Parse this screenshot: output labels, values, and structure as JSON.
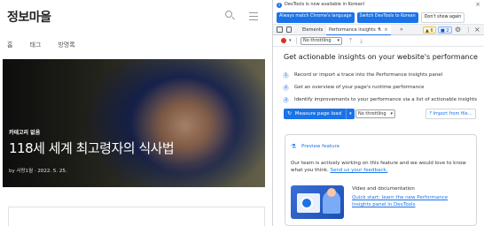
{
  "blog": {
    "site_title": "정보마을",
    "nav": [
      "홈",
      "태그",
      "방명록"
    ],
    "hero": {
      "category": "카테고리 없음",
      "title": "118세 세계 최고령자의 식사법",
      "meta_by": "by 사랑1월",
      "meta_date": "· 2022. 5. 25."
    }
  },
  "devtools": {
    "infobar": {
      "text": "DevTools is now available in Korean!",
      "buttons": [
        "Always match Chrome's language",
        "Switch DevTools to Korean",
        "Don't show again"
      ]
    },
    "tabs": {
      "elements": "Elements",
      "performance_insights": "Performance insights",
      "warnings": "6",
      "infos": "2"
    },
    "toolbar": {
      "throttle_label": "No throttling"
    },
    "performance": {
      "heading": "Get actionable insights on your website's performance",
      "steps": [
        {
          "num": "1",
          "text": "Record or import a trace into the Performance insights panel"
        },
        {
          "num": "2",
          "text": "Get an overview of your page's runtime performance"
        },
        {
          "num": "3",
          "text": "Identify improvements to your performance via a list of actionable insights"
        }
      ],
      "measure_label": "Measure page load",
      "throttle2_label": "No throttling",
      "import_label": "Import from file..."
    },
    "preview": {
      "title": "Preview feature",
      "desc": "Our team is actively working on this feature and we would love to know what you think.",
      "feedback_link": "Send us your feedback.",
      "video_label": "Video and documentation",
      "video_link": "Quick start: learn the new Performance Insights panel in DevTools"
    }
  },
  "colors": {
    "accent": "#1a73e8",
    "record": "#d93025"
  }
}
